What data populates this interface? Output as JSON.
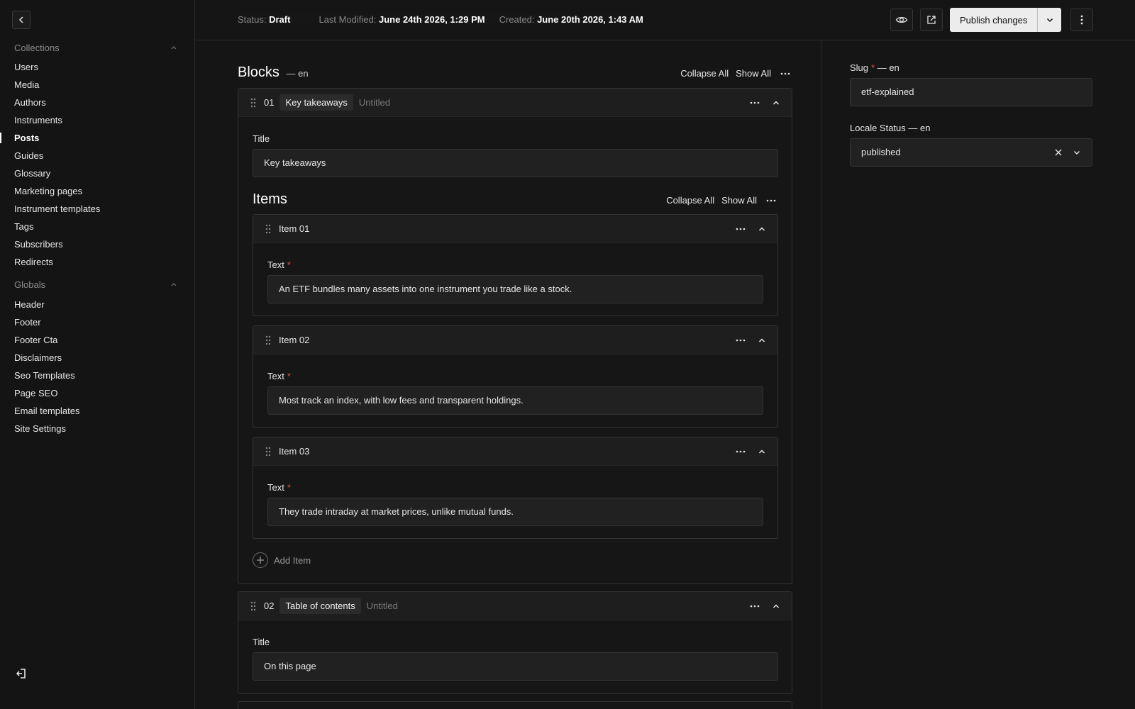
{
  "topbar": {
    "status_label": "Status:",
    "status_value": "Draft",
    "modified_label": "Last Modified:",
    "modified_value": "June 24th 2026, 1:29 PM",
    "created_label": "Created:",
    "created_value": "June 20th 2026, 1:43 AM",
    "publish_label": "Publish changes",
    "icons": [
      "eye-icon",
      "external-link-icon",
      "chevron-down-icon",
      "vertical-dots-icon"
    ]
  },
  "sidebar": {
    "collections_label": "Collections",
    "collections": [
      {
        "label": "Users",
        "active": false
      },
      {
        "label": "Media",
        "active": false
      },
      {
        "label": "Authors",
        "active": false
      },
      {
        "label": "Instruments",
        "active": false
      },
      {
        "label": "Posts",
        "active": true
      },
      {
        "label": "Guides",
        "active": false
      },
      {
        "label": "Glossary",
        "active": false
      },
      {
        "label": "Marketing pages",
        "active": false
      },
      {
        "label": "Instrument templates",
        "active": false
      },
      {
        "label": "Tags",
        "active": false
      },
      {
        "label": "Subscribers",
        "active": false
      },
      {
        "label": "Redirects",
        "active": false
      }
    ],
    "globals_label": "Globals",
    "globals": [
      {
        "label": "Header"
      },
      {
        "label": "Footer"
      },
      {
        "label": "Footer Cta"
      },
      {
        "label": "Disclaimers"
      },
      {
        "label": "Seo Templates"
      },
      {
        "label": "Page SEO"
      },
      {
        "label": "Email templates"
      },
      {
        "label": "Site Settings"
      }
    ]
  },
  "blocks": {
    "title": "Blocks",
    "locale": "— en",
    "collapse_all": "Collapse All",
    "show_all": "Show All",
    "list": [
      {
        "num": "01",
        "tag": "Key takeaways",
        "untitled": "Untitled",
        "title_label": "Title",
        "title_value": "Key takeaways",
        "items_title": "Items",
        "items": [
          {
            "label": "Item 01",
            "text_label": "Text",
            "text_value": "An ETF bundles many assets into one instrument you trade like a stock."
          },
          {
            "label": "Item 02",
            "text_label": "Text",
            "text_value": "Most track an index, with low fees and transparent holdings."
          },
          {
            "label": "Item 03",
            "text_label": "Text",
            "text_value": "They trade intraday at market prices, unlike mutual funds."
          }
        ],
        "add_item": "Add Item"
      },
      {
        "num": "02",
        "tag": "Table of contents",
        "untitled": "Untitled",
        "title_label": "Title",
        "title_value": "On this page"
      }
    ]
  },
  "right": {
    "slug_label": "Slug",
    "slug_locale": "— en",
    "slug_value": "etf-explained",
    "locale_status_label": "Locale Status",
    "locale_status_locale": "— en",
    "locale_status_value": "published"
  }
}
